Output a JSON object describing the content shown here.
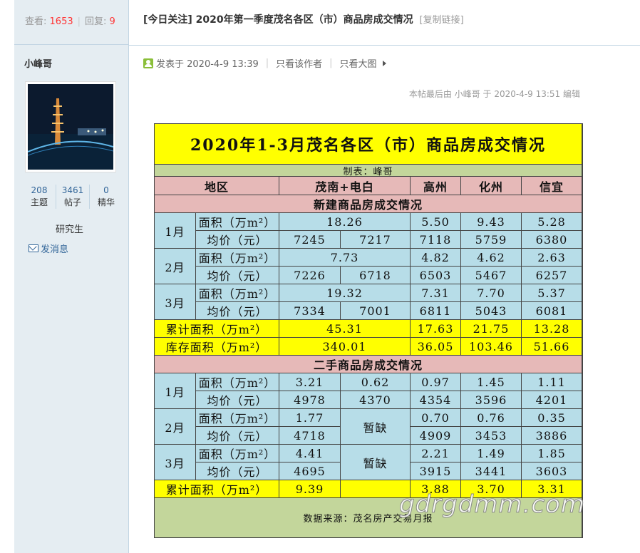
{
  "stats": {
    "views_label": "查看:",
    "views": "1653",
    "replies_label": "回复:",
    "replies": "9"
  },
  "thread": {
    "title": "[今日关注] 2020年第一季度茂名各区（市）商品房成交情况",
    "copy_link": "[复制链接]"
  },
  "author": {
    "name": "小峰哥",
    "rank": "研究生",
    "send_message": "发消息",
    "counts": [
      {
        "num": "208",
        "label": "主题"
      },
      {
        "num": "3461",
        "label": "帖子"
      },
      {
        "num": "0",
        "label": "精华"
      }
    ]
  },
  "post": {
    "posted": "发表于 2020-4-9 13:39",
    "only_author": "只看该作者",
    "big_image": "只看大图",
    "last_edit": "本帖最后由 小峰哥 于 2020-4-9 13:51 编辑"
  },
  "table": {
    "title": "2020年1-3月茂名各区（市）商品房成交情况",
    "maker": "制表：峰哥",
    "headers": [
      "地区",
      "茂南+电白",
      "高州",
      "化州",
      "信宜"
    ],
    "section_new": "新建商品房成交情况",
    "section_used": "二手商品房成交情况",
    "area_label": "面积（万m²）",
    "price_label": "均价（元）",
    "months": [
      "1月",
      "2月",
      "3月"
    ],
    "missing": "暂缺",
    "new": {
      "m1": {
        "area": [
          "18.26",
          "5.50",
          "9.43",
          "5.28"
        ],
        "price": [
          "7245",
          "7217",
          "7118",
          "5759",
          "6380"
        ]
      },
      "m2": {
        "area": [
          "7.73",
          "4.82",
          "4.62",
          "2.63"
        ],
        "price": [
          "7226",
          "6718",
          "6503",
          "5467",
          "6257"
        ]
      },
      "m3": {
        "area": [
          "19.32",
          "7.31",
          "7.70",
          "5.37"
        ],
        "price": [
          "7334",
          "7001",
          "6811",
          "5043",
          "6081"
        ]
      },
      "cum_label": "累计面积（万m²）",
      "cum": [
        "45.31",
        "17.63",
        "21.75",
        "13.28"
      ],
      "stock_label": "库存面积（万m²）",
      "stock": [
        "340.01",
        "36.05",
        "103.46",
        "51.66"
      ]
    },
    "used": {
      "m1": {
        "area": [
          "3.21",
          "0.62",
          "0.97",
          "1.45",
          "1.11"
        ],
        "price": [
          "4978",
          "4370",
          "4354",
          "3596",
          "4201"
        ]
      },
      "m2": {
        "area": [
          "1.77",
          "0.70",
          "0.76",
          "0.35"
        ],
        "price": [
          "4718",
          "4909",
          "3453",
          "3886"
        ]
      },
      "m3": {
        "area": [
          "4.41",
          "2.21",
          "1.49",
          "1.85"
        ],
        "price": [
          "4695",
          "3915",
          "3441",
          "3603"
        ]
      },
      "cum_label": "累计面积（万m²）",
      "cum": [
        "9.39",
        "",
        "3.88",
        "3.70",
        "3.31"
      ]
    },
    "source": "数据来源：茂名房产交易月报"
  },
  "watermark": "gdrgdmm.com"
}
